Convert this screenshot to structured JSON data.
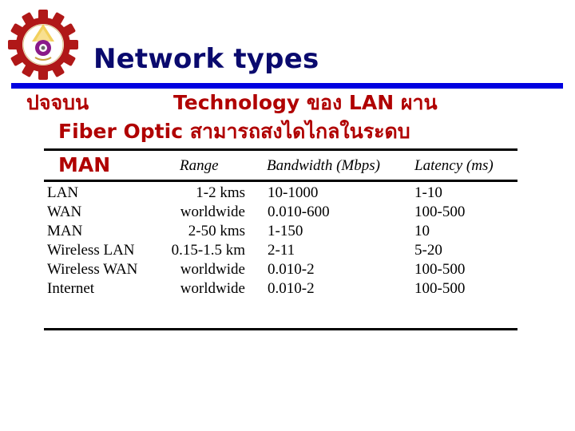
{
  "slide": {
    "title": "Network types",
    "subtitle_line1_thai": "ปจจบน",
    "subtitle_line1_rest": "Technology ของ LAN ผาน",
    "subtitle_line2": "Fiber Optic สามารถสงไดไกลในระดบ",
    "subtitle_line3": "MAN",
    "colors": {
      "title": "#0a0a6e",
      "title_bar": "#0000e0",
      "subtitle": "#b00000",
      "logo_gear": "#b01818"
    },
    "logo_icon": "university-gear-emblem"
  },
  "table": {
    "headers": {
      "type": "",
      "range": "Range",
      "bandwidth": "Bandwidth (Mbps)",
      "latency": "Latency (ms)"
    },
    "rows": [
      {
        "type": "LAN",
        "range": "1-2 kms",
        "bandwidth": "10-1000",
        "latency": "1-10"
      },
      {
        "type": "WAN",
        "range": "worldwide",
        "bandwidth": "0.010-600",
        "latency": "100-500"
      },
      {
        "type": "MAN",
        "range": "2-50 kms",
        "bandwidth": "1-150",
        "latency": "10"
      },
      {
        "type": "Wireless LAN",
        "range": "0.15-1.5 km",
        "bandwidth": "2-11",
        "latency": "5-20"
      },
      {
        "type": "Wireless WAN",
        "range": "worldwide",
        "bandwidth": "0.010-2",
        "latency": "100-500"
      },
      {
        "type": "Internet",
        "range": "worldwide",
        "bandwidth": "0.010-2",
        "latency": "100-500"
      }
    ]
  }
}
